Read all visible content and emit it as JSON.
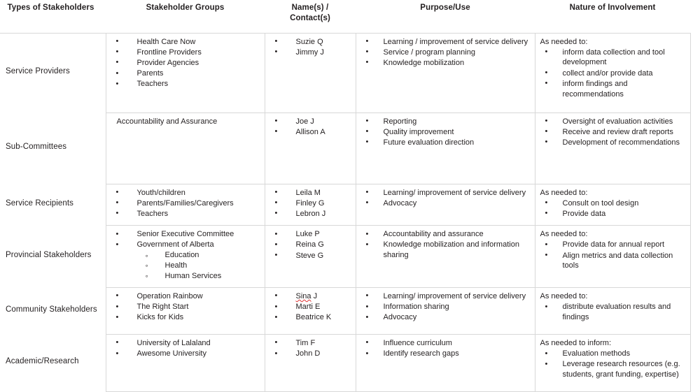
{
  "table": {
    "columns": [
      "Types of Stakeholders",
      "Stakeholder Groups",
      "Name(s) / Contact(s)",
      "Purpose/Use",
      "Nature of Involvement"
    ],
    "columns_lines": {
      "c3_line1": "Name(s) /",
      "c3_line2": "Contact(s)"
    },
    "rows": [
      {
        "type": "Service Providers",
        "groups": [
          "Health Care Now",
          "Frontline Providers",
          "Provider Agencies",
          "Parents",
          "Teachers"
        ],
        "groups_style": "bullets",
        "names": [
          "Suzie Q",
          "Jimmy J"
        ],
        "purpose": [
          "Learning / improvement of service delivery",
          "Service / program planning",
          "Knowledge mobilization"
        ],
        "nature_lead": "As needed to:",
        "nature": [
          "inform data collection and tool development",
          "collect and/or provide data",
          "inform findings and recommendations"
        ]
      },
      {
        "type": "Sub-Committees",
        "groups": [
          "Accountability and Assurance"
        ],
        "groups_style": "plain",
        "names": [
          "Joe J",
          "Allison  A"
        ],
        "purpose": [
          "Reporting",
          "Quality improvement",
          "Future evaluation direction"
        ],
        "nature_lead": "",
        "nature": [
          "Oversight of evaluation activities",
          "Receive and review draft reports",
          "Development of recommendations"
        ]
      },
      {
        "type": "Service Recipients",
        "groups": [
          "Youth/children",
          "Parents/Families/Caregivers",
          "Teachers"
        ],
        "groups_style": "bullets",
        "names": [
          "Leila M",
          "Finley G",
          "Lebron J"
        ],
        "purpose": [
          "Learning/ improvement of service delivery",
          "Advocacy"
        ],
        "nature_lead": "As needed to:",
        "nature": [
          "Consult on tool design",
          "Provide data"
        ]
      },
      {
        "type": "Provincial Stakeholders",
        "groups": [
          "Senior Executive Committee",
          "Government of Alberta"
        ],
        "groups_style": "bullets",
        "subgroups": [
          "Education",
          "Health",
          "Human Services"
        ],
        "names": [
          "Luke P",
          "Reina G",
          "Steve G"
        ],
        "purpose": [
          "Accountability and assurance",
          "Knowledge mobilization and information sharing"
        ],
        "nature_lead": "As needed to:",
        "nature": [
          "Provide data for annual report",
          "Align metrics and data collection tools"
        ]
      },
      {
        "type": "Community Stakeholders",
        "groups": [
          "Operation Rainbow",
          "The Right Start",
          "Kicks for Kids"
        ],
        "groups_style": "bullets",
        "names": [
          "Sina J",
          "Marti E",
          "Beatrice K"
        ],
        "names_misspelled": [
          "Sina"
        ],
        "purpose": [
          "Learning/ improvement of service delivery",
          "Information sharing",
          "Advocacy"
        ],
        "nature_lead": "As needed to:",
        "nature": [
          "distribute  evaluation results and findings"
        ]
      },
      {
        "type": "Academic/Research",
        "groups": [
          "University of Lalaland",
          "Awesome University"
        ],
        "groups_style": "bullets",
        "names": [
          "Tim F",
          "John D"
        ],
        "purpose": [
          "Influence curriculum",
          "Identify research gaps"
        ],
        "nature_lead": "As needed to inform:",
        "nature": [
          "Evaluation methods",
          "Leverage research resources (e.g. students, grant funding, expertise)"
        ]
      }
    ]
  },
  "colors": {
    "text": "#231f20",
    "border": "#d8d8d8",
    "background": "#ffffff",
    "spellcheck": "#e03030"
  }
}
